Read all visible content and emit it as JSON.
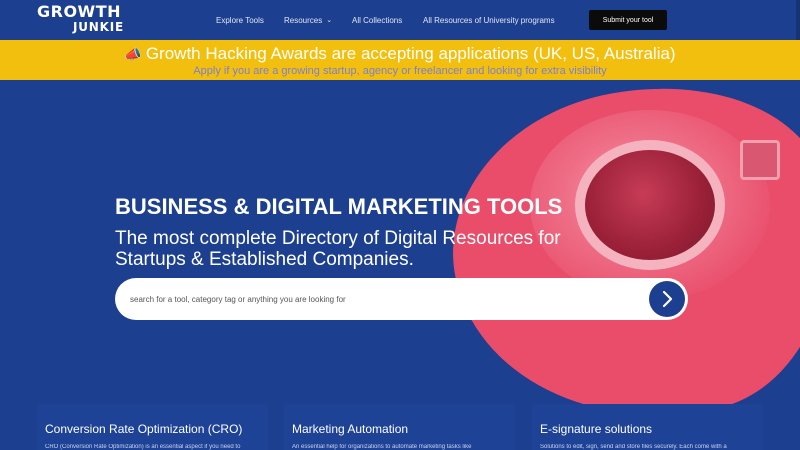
{
  "header": {
    "logo_line1": "GROWTH",
    "logo_line2": "JUNKIE",
    "nav": [
      {
        "label": "Explore Tools"
      },
      {
        "label": "Resources",
        "has_dropdown": true
      },
      {
        "label": "All Collections"
      },
      {
        "label": "All Resources of University programs"
      }
    ],
    "submit_label": "Submit your tool"
  },
  "announcement": {
    "title": "Growth Hacking Awards are accepting applications (UK, US, Australia)",
    "subtitle": "Apply if you are a growing startup, agency or freelancer and looking for extra visibility",
    "icon": "megaphone-icon"
  },
  "hero": {
    "title": "BUSINESS & DIGITAL MARKETING TOOLS",
    "subtitle": "The most complete Directory of Digital Resources for Startups & Established Companies.",
    "search": {
      "placeholder": "search for a tool, category tag or anything you are looking for",
      "value": ""
    }
  },
  "cards": [
    {
      "title": "Conversion Rate Optimization (CRO)",
      "desc": "CRO (Conversion Rate Optimization) is an essential aspect if you need to"
    },
    {
      "title": "Marketing Automation",
      "desc": "An essential help for organizations to automate marketing tasks like"
    },
    {
      "title": "E-signature solutions",
      "desc": "Solutions to edit, sign, send and store files securely. Each come with a"
    }
  ],
  "colors": {
    "primary": "#1d3f8f",
    "accent_yellow": "#f3bf0e",
    "accent_pink": "#ea4d6a",
    "button_dark": "#0b0b0b"
  }
}
